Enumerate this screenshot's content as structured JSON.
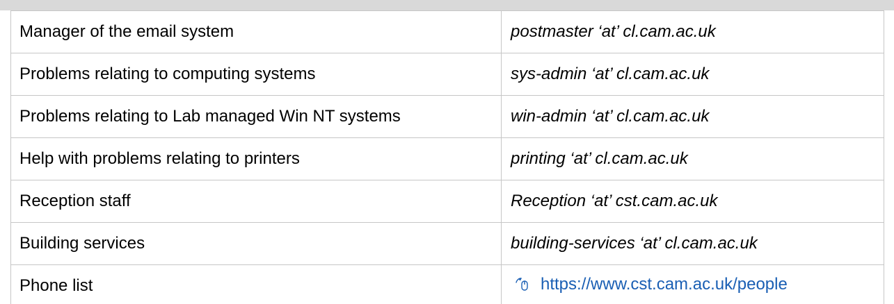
{
  "contacts": {
    "rows": [
      {
        "description": "Manager of the email system",
        "address": "postmaster ‘at’ cl.cam.ac.uk"
      },
      {
        "description": "Problems relating to computing systems",
        "address": "sys-admin ‘at’ cl.cam.ac.uk"
      },
      {
        "description": "Problems relating to Lab managed Win NT systems",
        "address": "win-admin ‘at’ cl.cam.ac.uk"
      },
      {
        "description": "Help with problems relating to printers",
        "address": "printing ‘at’ cl.cam.ac.uk"
      },
      {
        "description": "Reception staff",
        "address": "Reception ‘at’ cst.cam.ac.uk"
      },
      {
        "description": "Building services",
        "address": "building-services ‘at’ cl.cam.ac.uk"
      }
    ],
    "phone_list": {
      "description": "Phone list",
      "link_text": "https://www.cst.cam.ac.uk/people",
      "link_icon": "mouse-icon",
      "link_color": "#1a5fb4"
    }
  }
}
